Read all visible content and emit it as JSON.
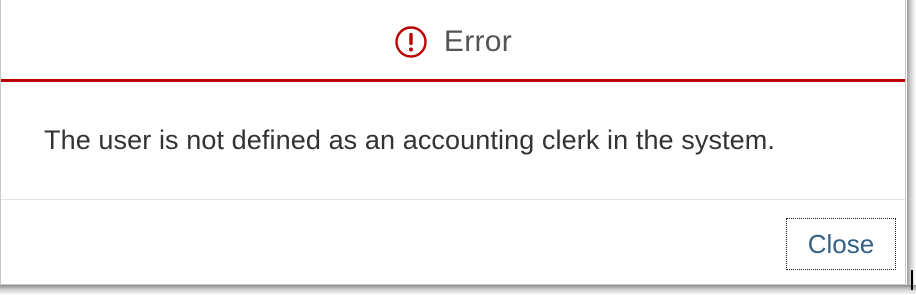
{
  "dialog": {
    "title": "Error",
    "icon": "error-circle-icon",
    "message": "The user is not defined as an accounting clerk in the system.",
    "close_label": "Close"
  },
  "colors": {
    "error_red": "#bb0000",
    "title_gray": "#555555",
    "message_text": "#333333",
    "link_blue": "#346187"
  }
}
